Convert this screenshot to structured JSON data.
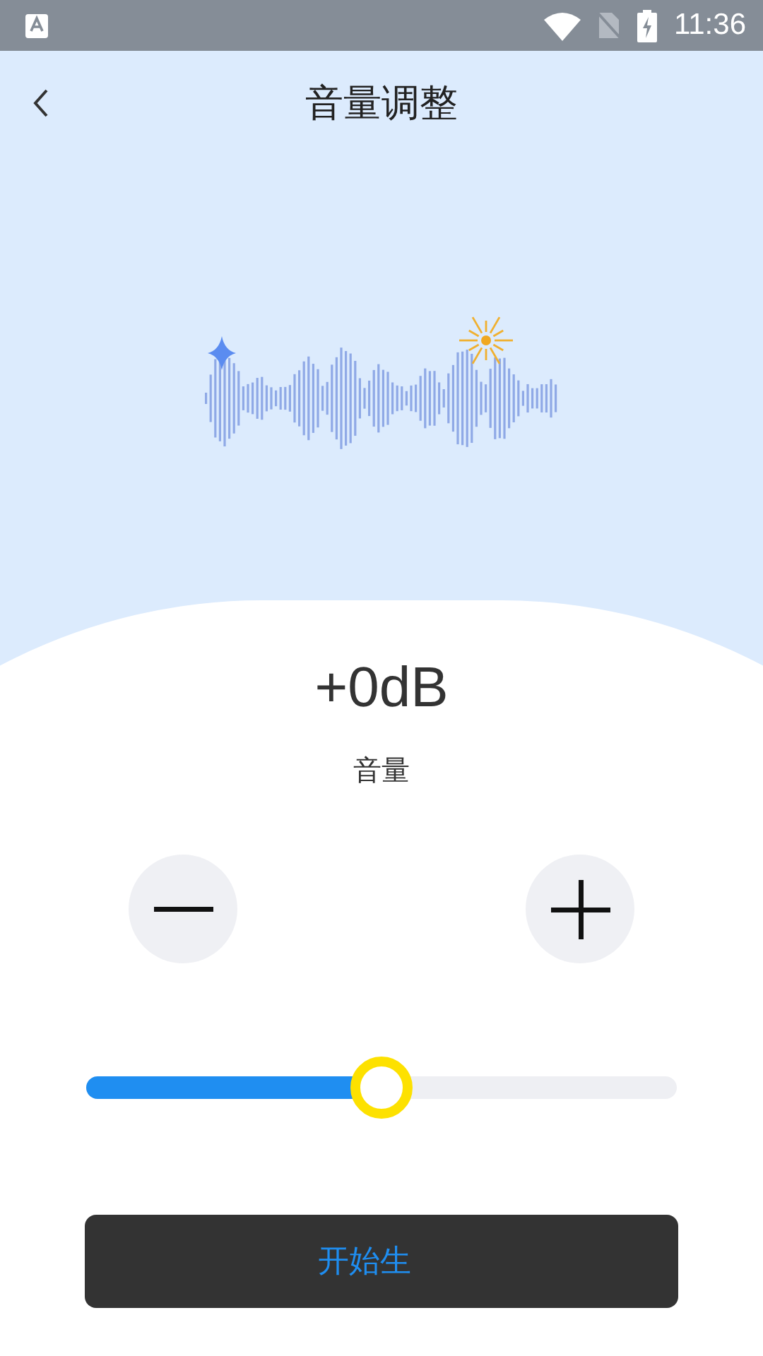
{
  "status_bar": {
    "time": "11:36"
  },
  "header": {
    "title": "音量调整"
  },
  "volume": {
    "reading": "+0dB",
    "label": "音量"
  },
  "slider": {
    "level": 0.5
  },
  "action_button": {
    "label": "开始生"
  }
}
